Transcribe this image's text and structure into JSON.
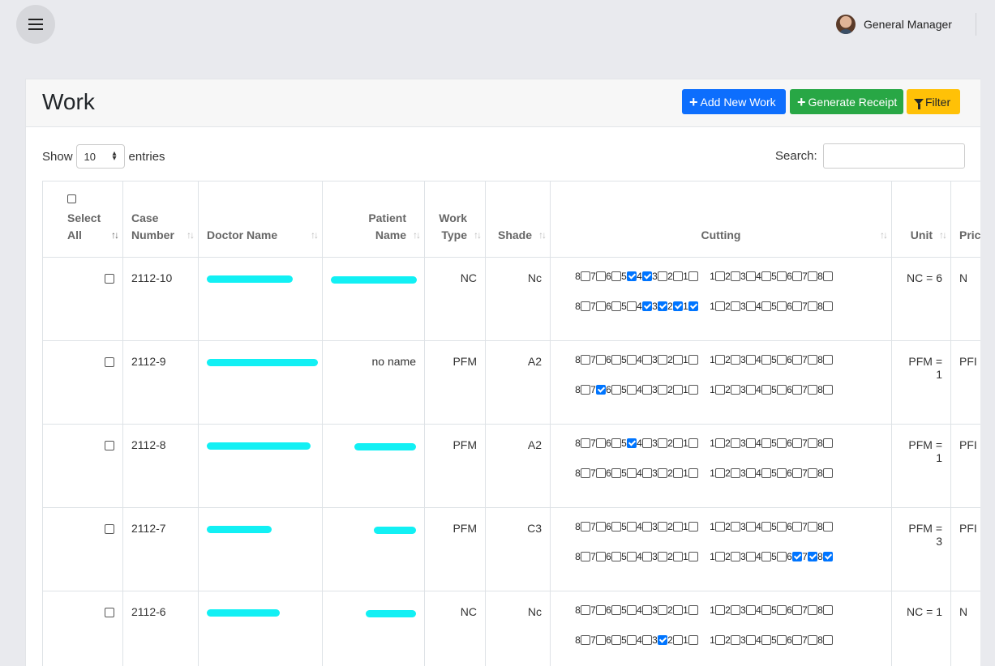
{
  "header": {
    "user_name": "General Manager",
    "menu_icon": "hamburger-icon"
  },
  "card": {
    "title": "Work",
    "buttons": {
      "add_new_work": "Add New Work",
      "generate_receipt": "Generate Receipt",
      "filter": "Filter"
    }
  },
  "controls": {
    "show_label": "Show",
    "entries_value": "10",
    "entries_label": "entries",
    "search_label": "Search:",
    "search_value": ""
  },
  "table": {
    "columns": [
      "Select All",
      "Case Number",
      "Doctor Name",
      "Patient Name",
      "Work Type",
      "Shade",
      "Cutting",
      "Unit",
      "Price"
    ],
    "column_display": {
      "select_all_1": "Select",
      "select_all_2": "All",
      "case_number_1": "Case",
      "case_number_2": "Number",
      "doctor_name": "Doctor Name",
      "patient_name_1": "Patient",
      "patient_name_2": "Name",
      "work_type_1": "Work",
      "work_type_2": "Type",
      "shade": "Shade",
      "cutting": "Cutting",
      "unit": "Unit",
      "price": "Pric"
    },
    "rows": [
      {
        "case": "2112-10",
        "doctor": "",
        "patient": "",
        "work_type": "NC",
        "shade": "Nc",
        "unit": "NC = 6",
        "price": "N",
        "checked": {
          "r1": [
            5,
            4
          ],
          "r1b": [],
          "r2": [
            4,
            3,
            2,
            1
          ],
          "r2b": []
        }
      },
      {
        "case": "2112-9",
        "doctor": "",
        "patient": "no name",
        "work_type": "PFM",
        "shade": "A2",
        "unit": "PFM = 1",
        "price": "PFI",
        "checked": {
          "r1": [],
          "r1b": [],
          "r2": [
            7
          ],
          "r2b": []
        }
      },
      {
        "case": "2112-8",
        "doctor": "",
        "patient": "",
        "work_type": "PFM",
        "shade": "A2",
        "unit": "PFM = 1",
        "price": "PFI",
        "checked": {
          "r1": [
            5
          ],
          "r1b": [],
          "r2": [],
          "r2b": []
        }
      },
      {
        "case": "2112-7",
        "doctor": "",
        "patient": "",
        "work_type": "PFM",
        "shade": "C3",
        "unit": "PFM = 3",
        "price": "PFI",
        "checked": {
          "r1": [],
          "r1b": [],
          "r2": [],
          "r2b": [
            6,
            7,
            8
          ]
        }
      },
      {
        "case": "2112-6",
        "doctor": "",
        "patient": "",
        "work_type": "NC",
        "shade": "Nc",
        "unit": "NC = 1",
        "price": "N",
        "checked": {
          "r1": [],
          "r1b": [],
          "r2": [
            3
          ],
          "r2b": []
        }
      }
    ]
  },
  "colors": {
    "background": "#e9eaee",
    "primary": "#0d6efd",
    "success": "#28a745",
    "warning": "#ffc107",
    "redaction": "#12f0f4",
    "checkbox_checked": "#0075ff"
  }
}
